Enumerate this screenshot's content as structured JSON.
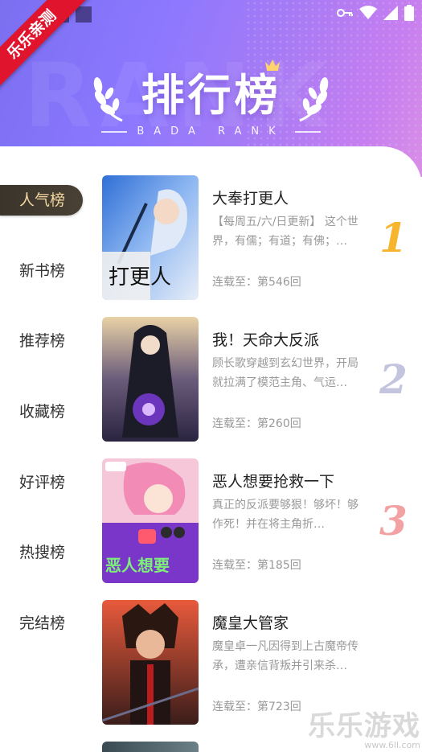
{
  "status_bar": {
    "icons": [
      "notification-square-icon",
      "notification-square-icon",
      "key-icon",
      "wifi-icon",
      "signal-icon",
      "battery-icon"
    ]
  },
  "ribbon": {
    "text": "乐乐亲测",
    "color": "#e0142d"
  },
  "header": {
    "title": "排行榜",
    "subtitle": "BADA RANK",
    "gradient": [
      "#7b6ff0",
      "#c67ef0"
    ]
  },
  "sidebar": {
    "active_index": 0,
    "items": [
      {
        "label": "人气榜"
      },
      {
        "label": "新书榜"
      },
      {
        "label": "推荐榜"
      },
      {
        "label": "收藏榜"
      },
      {
        "label": "好评榜"
      },
      {
        "label": "热搜榜"
      },
      {
        "label": "完结榜"
      }
    ]
  },
  "books": [
    {
      "title": "大奉打更人",
      "desc": "【每周五/六/日更新】 这个世界，有儒；有道；有佛；…",
      "latest": "连载至：第546回",
      "rank": "1"
    },
    {
      "title": "我！天命大反派",
      "desc": "顾长歌穿越到玄幻世界，开局就拉满了模范主角、气运…",
      "latest": "连载至：第260回",
      "rank": "2"
    },
    {
      "title": "恶人想要抢救一下",
      "desc": "真正的反派要够狠！够坏！够作死！并在将主角折…",
      "latest": "连载至：第185回",
      "rank": "3"
    },
    {
      "title": "魔皇大管家",
      "desc": "魔皇卓一凡因得到上古魔帝传承，遭亲信背叛并引来杀…",
      "latest": "连载至：第723回",
      "rank": ""
    }
  ],
  "watermark": {
    "main": "乐乐游戏",
    "sub": "www.6ll.com"
  },
  "colors": {
    "rank1": "#f7b52d",
    "rank2": "#c3c4dd",
    "rank3": "#f2a2a2",
    "active_tab_bg": "#3a342b",
    "active_tab_text": "#f3d9a1"
  }
}
